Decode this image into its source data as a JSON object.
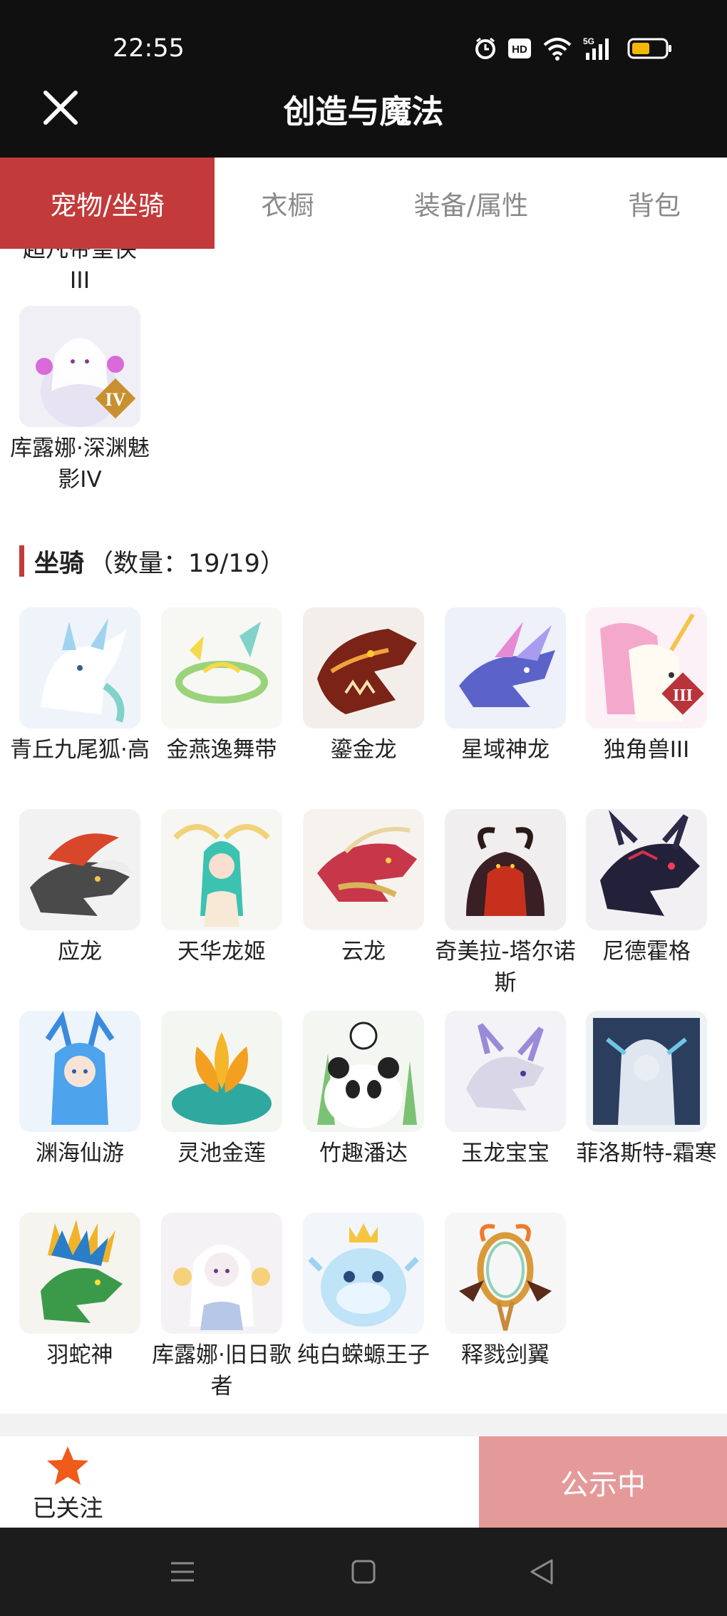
{
  "status_bar": {
    "time": "22:55",
    "hd_label": "HD",
    "network_label": "5G"
  },
  "header": {
    "title": "创造与魔法",
    "close_icon": "close-icon"
  },
  "tabs": [
    {
      "label": "宠物/坐骑",
      "active": true
    },
    {
      "label": "衣橱",
      "active": false
    },
    {
      "label": "装备/属性",
      "active": false
    },
    {
      "label": "背包",
      "active": false
    }
  ],
  "pets": {
    "cut_labels": [
      "超凡帝皇侠",
      "",
      "",
      "",
      ""
    ],
    "cut_label_line2": "III",
    "items": [
      {
        "name": "库露娜·深渊魅影IV",
        "badge": "IV"
      }
    ]
  },
  "mounts": {
    "title": "坐骑",
    "count_text": "（数量：19/19）",
    "items": [
      {
        "name": "青丘九尾狐·高"
      },
      {
        "name": "金燕逸舞带"
      },
      {
        "name": "鎏金龙"
      },
      {
        "name": "星域神龙"
      },
      {
        "name": "独角兽III",
        "badge": "III"
      },
      {
        "name": "应龙"
      },
      {
        "name": "天华龙姬"
      },
      {
        "name": "云龙"
      },
      {
        "name": "奇美拉-塔尔诺斯"
      },
      {
        "name": "尼德霍格"
      },
      {
        "name": "渊海仙游"
      },
      {
        "name": "灵池金莲"
      },
      {
        "name": "竹趣潘达"
      },
      {
        "name": "玉龙宝宝"
      },
      {
        "name": "菲洛斯特-霜寒"
      },
      {
        "name": "羽蛇神"
      },
      {
        "name": "库露娜·旧日歌者"
      },
      {
        "name": "纯白蝾螈王子"
      },
      {
        "name": "释戮剑翼"
      }
    ]
  },
  "bottom_bar": {
    "follow_label": "已关注",
    "publish_label": "公示中"
  },
  "colors": {
    "accent": "#c33a3a",
    "publish": "#e59a9a",
    "star": "#f05a1a"
  }
}
